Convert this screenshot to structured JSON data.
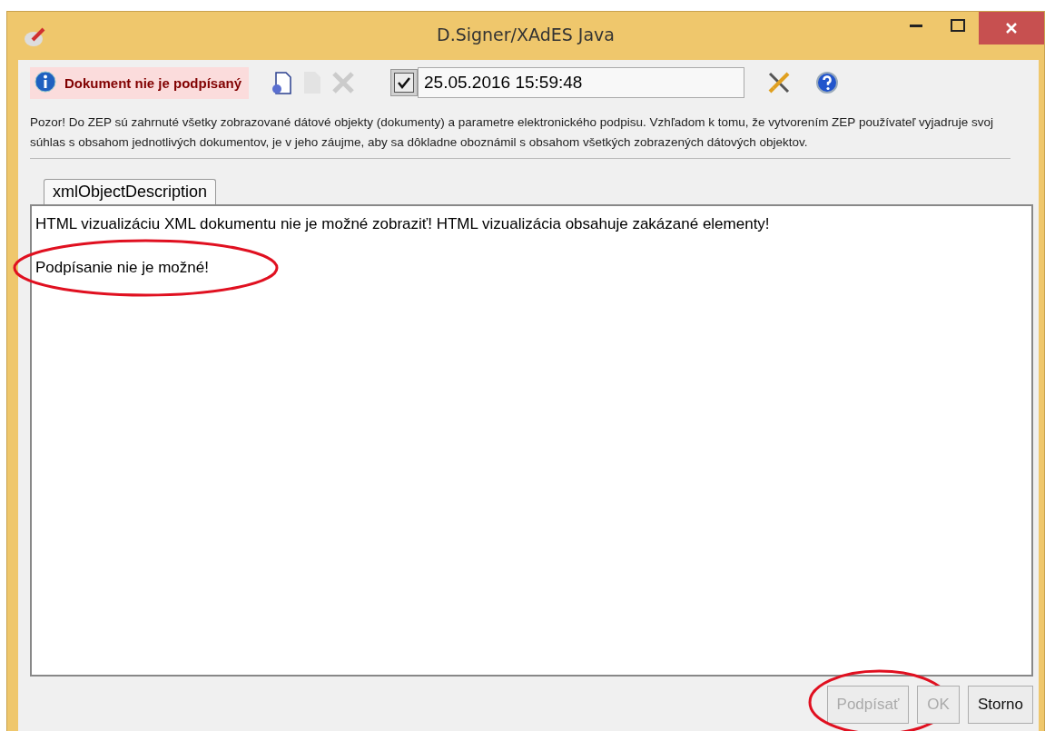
{
  "window": {
    "title": "D.Signer/XAdES Java"
  },
  "toolbar": {
    "status": "Dokument nie je podpísaný",
    "tools": [
      {
        "kind": "sign-file",
        "disabled": false
      },
      {
        "kind": "document",
        "disabled": true
      },
      {
        "kind": "delete",
        "disabled": true
      }
    ],
    "timestamp": {
      "checked": true,
      "value": "25.05.2016 15:59:48"
    }
  },
  "notice": "Pozor! Do ZEP sú zahrnuté všetky zobrazované dátové objekty (dokumenty) a parametre elektronického podpisu. Vzhľadom k tomu, že vytvorením ZEP používateľ vyjadruje svoj súhlas s obsahom jednotlivých dokumentov, je v jeho záujme, aby sa dôkladne oboznámil s obsahom všetkých zobrazených dátových objektov.",
  "tabs": [
    {
      "label": "xmlObjectDescription",
      "selected": true
    }
  ],
  "content": [
    {
      "text": "HTML vizualizáciu XML dokumentu nie je možné zobraziť! HTML vizualizácia obsahuje zakázané elementy!",
      "circled": false
    },
    {
      "text": "Podpísanie nie je možné!",
      "circled": true
    }
  ],
  "buttons": [
    {
      "label": "Podpísať",
      "disabled": true,
      "circled": true
    },
    {
      "label": "OK",
      "disabled": true,
      "circled": false
    },
    {
      "label": "Storno",
      "disabled": false,
      "circled": false
    }
  ]
}
